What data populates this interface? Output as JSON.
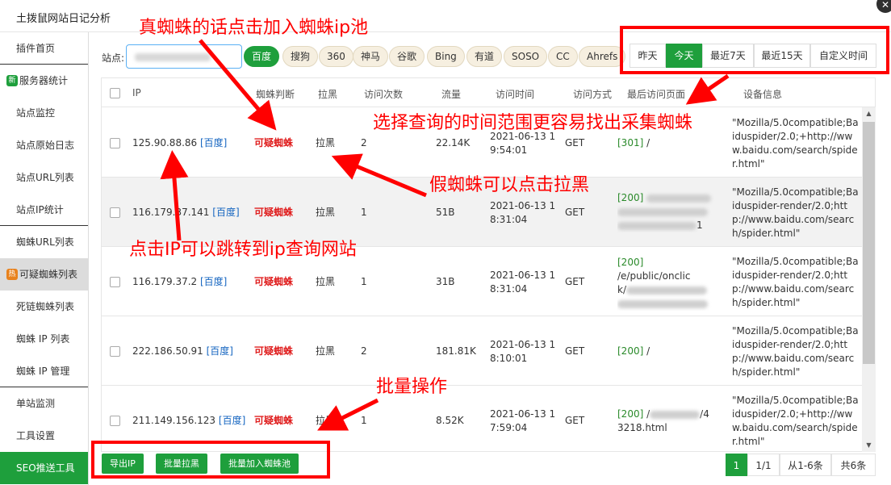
{
  "window": {
    "title": "土拨鼠网站日记分析",
    "close_glyph": "✕"
  },
  "sidebar": {
    "items": [
      {
        "label": "插件首页"
      },
      {
        "tag": "新",
        "label": "服务器统计"
      },
      {
        "label": "站点监控"
      },
      {
        "label": "站点原始日志"
      },
      {
        "label": "站点URL列表"
      },
      {
        "label": "站点IP统计"
      },
      {
        "label": "蜘蛛URL列表"
      },
      {
        "tag": "热",
        "label": "可疑蜘蛛列表"
      },
      {
        "label": "死链蜘蛛列表"
      },
      {
        "label": "蜘蛛 IP 列表"
      },
      {
        "label": "蜘蛛 IP 管理"
      },
      {
        "label": "单站监测"
      },
      {
        "label": "工具设置"
      },
      {
        "label": "SEO推送工具"
      }
    ]
  },
  "toolbar": {
    "site_label": "站点:",
    "engines": [
      "百度",
      "搜狗",
      "360",
      "神马",
      "谷歌",
      "Bing",
      "有道",
      "SOSO",
      "CC",
      "Ahrefs"
    ],
    "date_ranges": [
      "昨天",
      "今天",
      "最近7天",
      "最近15天",
      "自定义时间"
    ]
  },
  "table": {
    "headers": [
      "IP",
      "蜘蛛判断",
      "拉黑",
      "访问次数",
      "流量",
      "访问时间",
      "访问方式",
      "最后访问页面",
      "设备信息"
    ],
    "ip_query_label": "[百度]",
    "rows": [
      {
        "ip": "125.90.88.86",
        "judge": "可疑蜘蛛",
        "block": "拉黑",
        "visits": "2",
        "traffic": "22.14K",
        "time_date": "2021-06-13 1",
        "time_clock": "9:54:01",
        "method": "GET",
        "status": "[301]",
        "page_a": "/",
        "page_b": "",
        "page_c": "",
        "ua": "\"Mozilla/5.0compatible;Baiduspider/2.0;+http://www.baidu.com/search/spider.html\""
      },
      {
        "ip": "116.179.37.141",
        "judge": "可疑蜘蛛",
        "block": "拉黑",
        "visits": "1",
        "traffic": "51B",
        "time_date": "2021-06-13 1",
        "time_clock": "8:31:04",
        "method": "GET",
        "status": "[200]",
        "page_a": "",
        "page_b": "",
        "page_c": "1",
        "ua": "\"Mozilla/5.0compatible;Baiduspider-render/2.0;http://www.baidu.com/search/spider.html\""
      },
      {
        "ip": "116.179.37.2",
        "judge": "可疑蜘蛛",
        "block": "拉黑",
        "visits": "1",
        "traffic": "31B",
        "time_date": "2021-06-13 1",
        "time_clock": "8:31:04",
        "method": "GET",
        "status": "[200]",
        "page_a": "/e/public/onclic",
        "page_b": "k/",
        "page_c": "",
        "ua": "\"Mozilla/5.0compatible;Baiduspider-render/2.0;http://www.baidu.com/search/spider.html\""
      },
      {
        "ip": "222.186.50.91",
        "judge": "可疑蜘蛛",
        "block": "拉黑",
        "visits": "2",
        "traffic": "181.81K",
        "time_date": "2021-06-13 1",
        "time_clock": "8:10:01",
        "method": "GET",
        "status": "[200]",
        "page_a": "/",
        "page_b": "",
        "page_c": "",
        "ua": "\"Mozilla/5.0compatible;Baiduspider-render/2.0;http://www.baidu.com/search/spider.html\""
      },
      {
        "ip": "211.149.156.123",
        "judge": "可疑蜘蛛",
        "block": "拉黑",
        "visits": "1",
        "traffic": "8.52K",
        "time_date": "2021-06-13 1",
        "time_clock": "7:59:04",
        "method": "GET",
        "status": "[200]",
        "page_a": "/",
        "page_b": "3218.html",
        "page_c": "/4",
        "ua": "\"Mozilla/5.0compatible;Baiduspider/2.0;+http://www.baidu.com/search/spider.html\""
      }
    ]
  },
  "bulk": {
    "export_ip": "导出IP",
    "bulk_block": "批量拉黑",
    "bulk_add_pool": "批量加入蜘蛛池"
  },
  "pagination": {
    "current": "1",
    "pages": "1/1",
    "range": "从1-6条",
    "total": "共6条"
  },
  "annotations": {
    "real_spider": "真蜘蛛的话点击加入蜘蛛ip池",
    "date_tip": "选择查询的时间范围更容易找出采集蜘蛛",
    "fake_spider": "假蜘蛛可以点击拉黑",
    "ip_tip": "点击IP可以跳转到ip查询网站",
    "bulk_tip": "批量操作"
  },
  "colors": {
    "accent": "#1e9f3c",
    "annotation": "#ff0000",
    "suspicious": "#e02020",
    "link": "#1565c0"
  },
  "icons": [
    "close-icon",
    "checkbox-icon",
    "scroll-up-icon",
    "scroll-down-icon"
  ]
}
